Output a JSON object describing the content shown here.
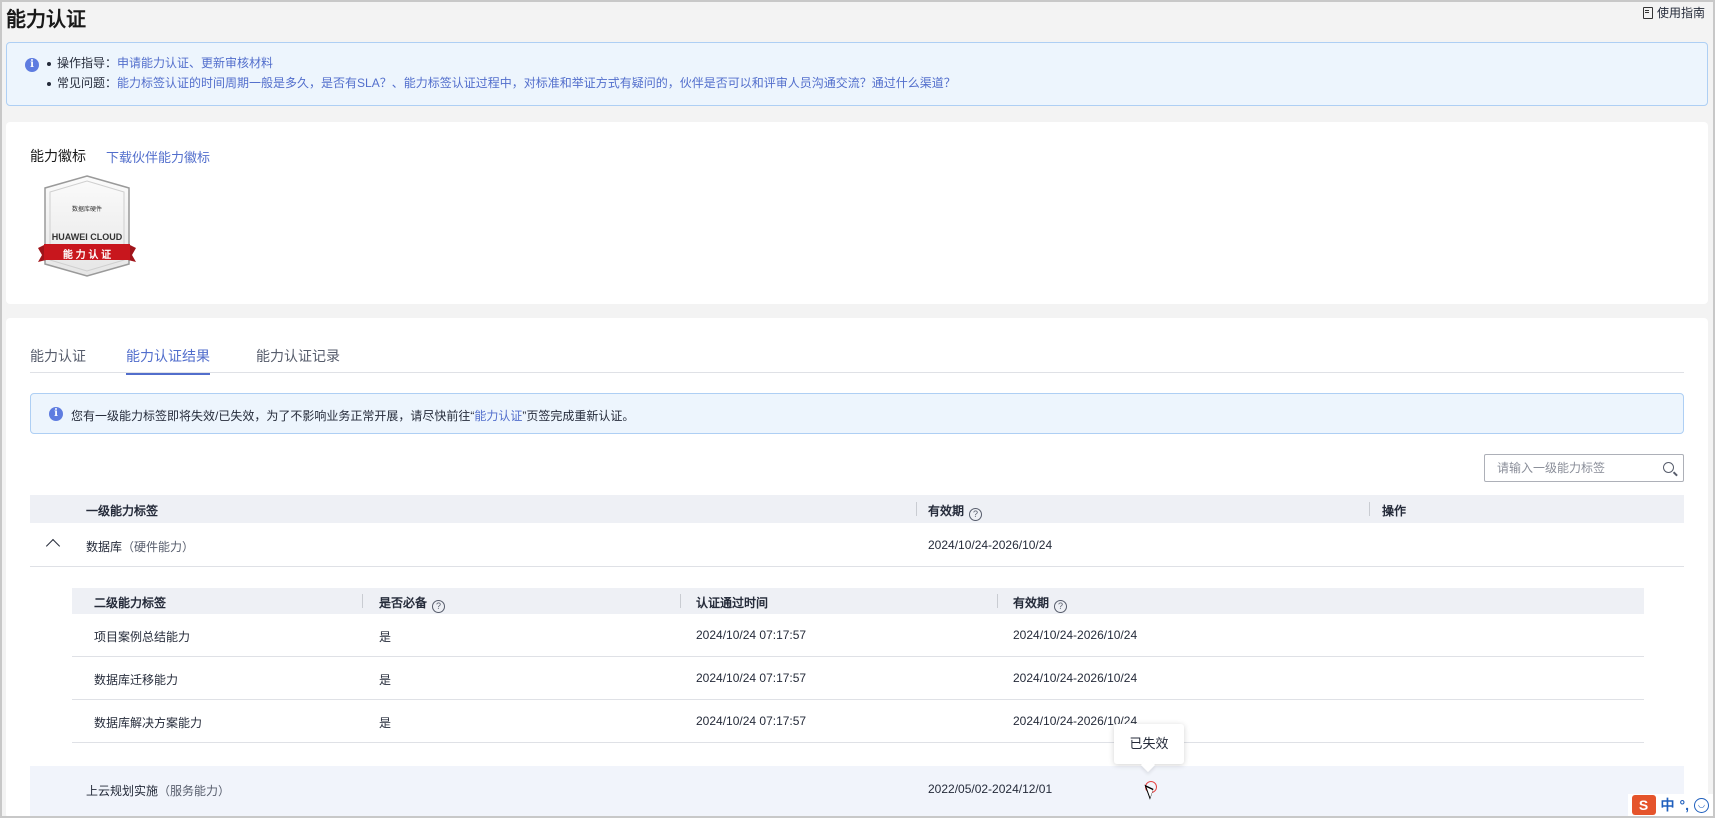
{
  "page": {
    "title": "能力认证",
    "guide_link": "使用指南"
  },
  "info_banner": {
    "line1_label": "操作指导：",
    "line1_link": "申请能力认证、更新审核材料",
    "line2_label": "常见问题：",
    "line2_link": "能力标签认证的时间周期一般是多久，是否有SLA？、能力标签认证过程中，对标准和举证方式有疑问的，伙伴是否可以和评审人员沟通交流？通过什么渠道？"
  },
  "badge_card": {
    "title": "能力徽标",
    "download_link": "下载伙伴能力徽标",
    "badge_top_text": "数据库硬件",
    "badge_brand": "HUAWEI CLOUD",
    "badge_ribbon": "能 力 认 证"
  },
  "tabs": [
    {
      "label": "能力认证",
      "active": false
    },
    {
      "label": "能力认证结果",
      "active": true
    },
    {
      "label": "能力认证记录",
      "active": false
    }
  ],
  "warn_banner": {
    "text_before": "您有一级能力标签即将失效/已失效，为了不影响业务正常开展，请尽快前往“",
    "link": "能力认证",
    "text_after": "”页签完成重新认证。"
  },
  "search": {
    "placeholder": "请输入一级能力标签"
  },
  "table": {
    "headers": {
      "label": "一级能力标签",
      "validity": "有效期",
      "action": "操作"
    },
    "rows": [
      {
        "name": "数据库",
        "type": "（硬件能力）",
        "validity": "2024/10/24-2026/10/24"
      },
      {
        "name": "上云规划实施",
        "type": "（服务能力）",
        "validity": "2022/05/02-2024/12/01"
      }
    ]
  },
  "subtable": {
    "headers": {
      "label": "二级能力标签",
      "required": "是否必备",
      "pass_time": "认证通过时间",
      "validity": "有效期"
    },
    "rows": [
      {
        "label": "项目案例总结能力",
        "required": "是",
        "pass_time": "2024/10/24 07:17:57",
        "validity": "2024/10/24-2026/10/24"
      },
      {
        "label": "数据库迁移能力",
        "required": "是",
        "pass_time": "2024/10/24 07:17:57",
        "validity": "2024/10/24-2026/10/24"
      },
      {
        "label": "数据库解决方案能力",
        "required": "是",
        "pass_time": "2024/10/24 07:17:57",
        "validity": "2024/10/24-2026/10/24"
      }
    ]
  },
  "tooltip": {
    "text": "已失效"
  },
  "ime": {
    "logo": "S",
    "lang": "中",
    "punct": "°,"
  },
  "colors": {
    "accent": "#526ecc",
    "banner_bg": "#edf5fd",
    "expired": "#e54545"
  }
}
